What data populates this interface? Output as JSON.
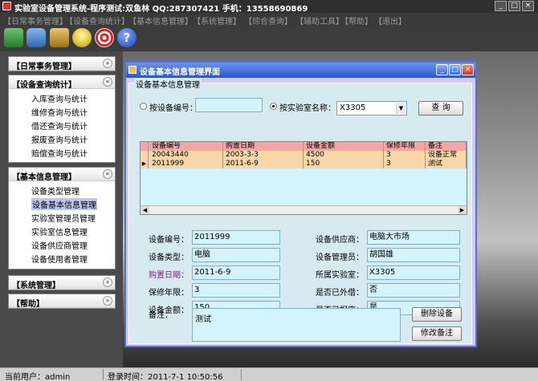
{
  "window": {
    "title": "实验室设备管理系统-程序测试:双鱼林 QQ:287307421 手机：13558690869"
  },
  "menubar": [
    "【日常事务管理】",
    "【设备查询统计】",
    "【基本信息管理】",
    "【系统管理】",
    "【综合查询】",
    "【辅助工具】",
    "【帮助】",
    "【退出】"
  ],
  "toolbar": {
    "help_glyph": "?"
  },
  "sidebar": {
    "daily": {
      "label": "【日常事务管理】",
      "toggle": "»"
    },
    "query": {
      "label": "【设备查询统计】",
      "toggle": "«",
      "items": [
        "入库查询与统计",
        "维修查询与统计",
        "借还查询与统计",
        "报废查询与统计",
        "赔偿查询与统计"
      ]
    },
    "basic": {
      "label": "【基本信息管理】",
      "toggle": "«",
      "items": [
        "设备类型管理",
        "设备基本信息管理",
        "实验室管理员管理",
        "实验室信息管理",
        "设备供应商管理",
        "设备使用者管理"
      ]
    },
    "system": {
      "label": "【系统管理】",
      "toggle": "»"
    },
    "help": {
      "label": "【帮助】",
      "toggle": "»"
    }
  },
  "dialog": {
    "title": "设备基本信息管理界面",
    "group_label": "设备基本信息管理",
    "search": {
      "by_number_label": "按设备编号：",
      "by_number_value": "",
      "by_lab_label": "按实验室名称：",
      "lab_selected": "X3305",
      "query_button": "查 询"
    },
    "grid": {
      "columns": [
        "设备编号",
        "购置日期",
        "设备金额",
        "保修年限",
        "备注"
      ],
      "rows": [
        [
          "20043440",
          "2003-3-3",
          "4500",
          "3",
          "设备正常"
        ],
        [
          "2011999",
          "2011-6-9",
          "150",
          "3",
          "测试"
        ]
      ],
      "row_pointer": "▶"
    },
    "form": {
      "equip_no_label": "设备编号：",
      "equip_no": "2011999",
      "supplier_label": "设备供应商：",
      "supplier": "电脑大市场",
      "type_label": "设备类型：",
      "type": "电脑",
      "manager_label": "设备管理员：",
      "manager": "胡国雄",
      "purchase_date_label": "购置日期：",
      "purchase_date": "2011-6-9",
      "lab_label": "所属实验室：",
      "lab": "X3305",
      "warranty_label": "保修年限：",
      "warranty": "3",
      "lent_label": "是否已外借：",
      "lent": "否",
      "amount_label": "设备金额：",
      "amount": "150",
      "scrapped_label": "是否已报废：",
      "scrapped": "是",
      "note_label": "备注：",
      "note": "测试"
    },
    "buttons": {
      "delete": "删除设备",
      "edit_note": "修改备注"
    }
  },
  "statusbar": {
    "user": "当前用户：admin",
    "login_time": "登录时间：2011-7-1 10:50:56"
  }
}
